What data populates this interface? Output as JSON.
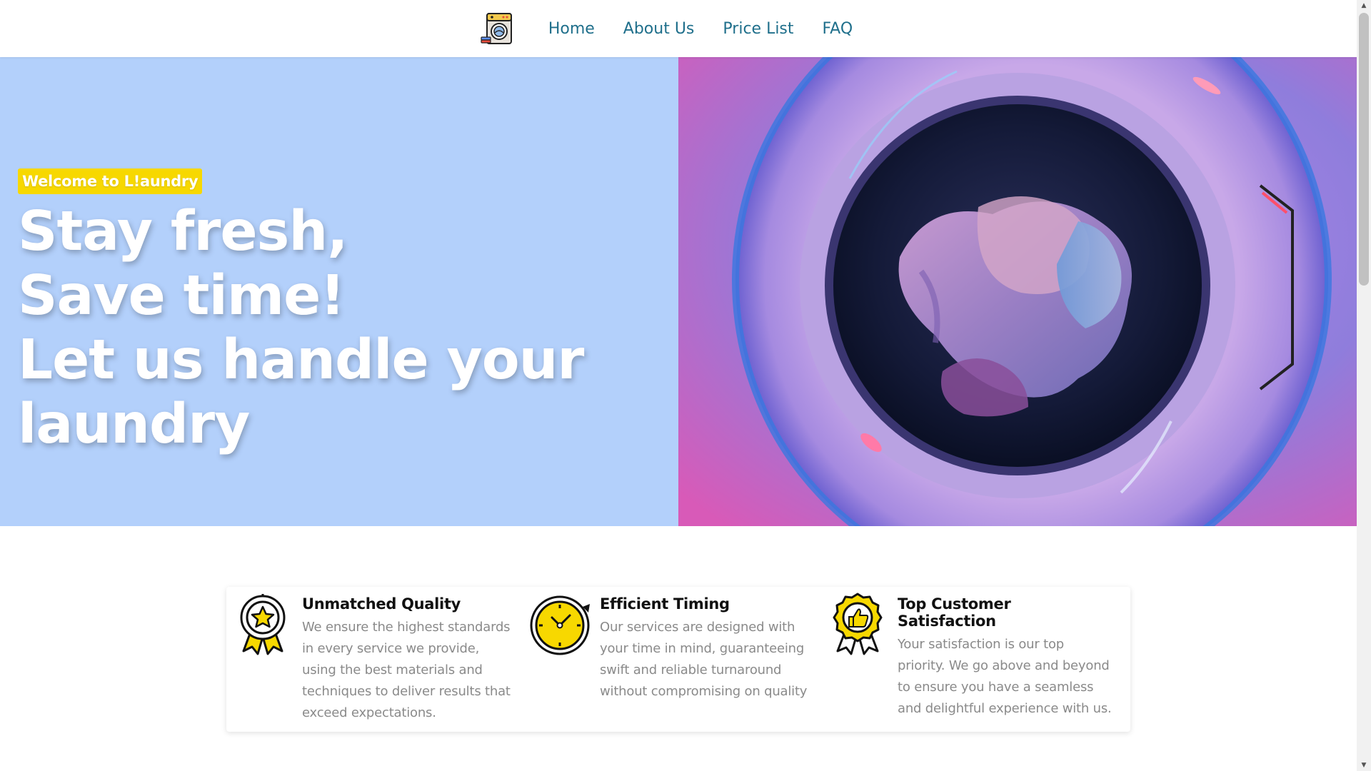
{
  "nav": {
    "logo_icon": "washing-machine-icon",
    "links": [
      "Home",
      "About Us",
      "Price List",
      "FAQ"
    ]
  },
  "hero": {
    "badge": "Welcome to L!aundry",
    "title_lines": [
      "Stay fresh,",
      "Save time!",
      "Let us handle your",
      "laundry"
    ],
    "image_icon": "washing-machine-drum-photo",
    "colors": {
      "left_bg": "#b3d0fb",
      "badge_bg": "#f7d800"
    }
  },
  "features": [
    {
      "icon": "award-ribbon-icon",
      "title": "Unmatched Quality",
      "description": "We ensure the highest standards in every service we provide, using the best materials and techniques to deliver results that exceed expectations."
    },
    {
      "icon": "clock-icon",
      "title": "Efficient Timing",
      "description": "Our services are designed with your time in mind, guaranteeing swift and reliable turnaround without compromising on quality"
    },
    {
      "icon": "thumbs-up-badge-icon",
      "title": "Top Customer Satisfaction",
      "description": "Your satisfaction is our top priority. We go above and beyond to ensure you have a seamless and delightful experience with us."
    }
  ]
}
